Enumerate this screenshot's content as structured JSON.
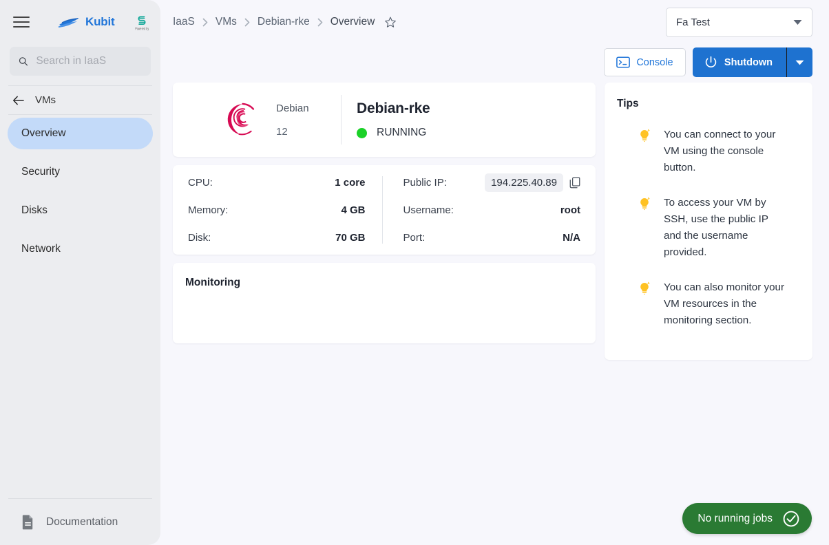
{
  "sidebar": {
    "brand_name": "Kubit",
    "partner_caption": "Powered by",
    "search_placeholder": "Search in IaaS",
    "search_value": "",
    "back_label": "VMs",
    "nav_items": [
      {
        "label": "Overview",
        "active": true
      },
      {
        "label": "Security",
        "active": false
      },
      {
        "label": "Disks",
        "active": false
      },
      {
        "label": "Network",
        "active": false
      }
    ],
    "documentation_label": "Documentation"
  },
  "topbar": {
    "breadcrumb": [
      "IaaS",
      "VMs",
      "Debian-rke",
      "Overview"
    ],
    "project_selector": "Fa Test"
  },
  "actions": {
    "console_label": "Console",
    "shutdown_label": "Shutdown"
  },
  "vm": {
    "distro_name": "Debian",
    "distro_version": "12",
    "name": "Debian-rke",
    "status": "RUNNING",
    "status_color": "#1bd128",
    "specs_left": [
      {
        "key": "CPU:",
        "value": "1 core"
      },
      {
        "key": "Memory:",
        "value": "4 GB"
      },
      {
        "key": "Disk:",
        "value": "70 GB"
      }
    ],
    "specs_right": [
      {
        "key": "Public IP:",
        "value": "194.225.40.89"
      },
      {
        "key": "Username:",
        "value": "root"
      },
      {
        "key": "Port:",
        "value": "N/A"
      }
    ]
  },
  "monitoring": {
    "title": "Monitoring"
  },
  "tips": {
    "title": "Tips",
    "items": [
      "You can connect to your VM using the console button.",
      "To access your VM by SSH, use the public IP and the username provided.",
      "You can also monitor your VM resources in the monitoring section."
    ]
  },
  "toast": {
    "label": "No running jobs",
    "color": "#2a7a33"
  },
  "colors": {
    "accent_blue": "#1e72d0",
    "link_blue": "#2176d9",
    "active_nav": "#c3daf9",
    "debian_red": "#d70a53",
    "tip_yellow": "#ffc223"
  }
}
